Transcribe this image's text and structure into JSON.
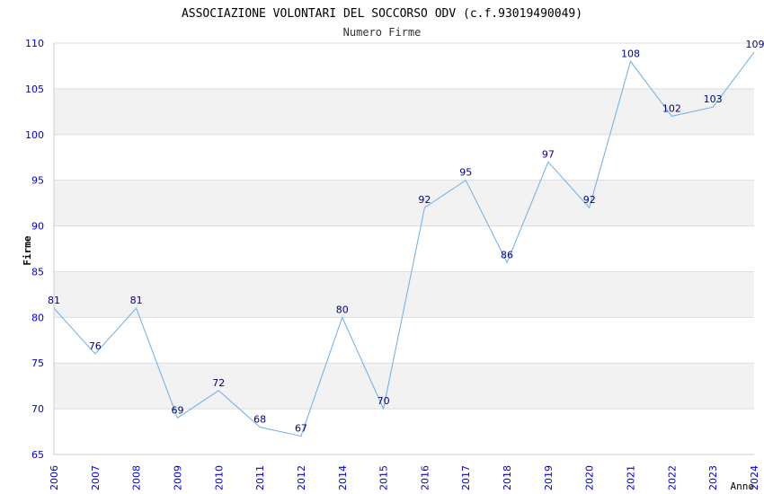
{
  "chart_data": {
    "type": "line",
    "title": "ASSOCIAZIONE VOLONTARI DEL SOCCORSO ODV (c.f.93019490049)",
    "subtitle": "Numero Firme",
    "xlabel": "Anno",
    "ylabel": "Firme",
    "ylim": [
      65,
      110
    ],
    "yticks": [
      65,
      70,
      75,
      80,
      85,
      90,
      95,
      100,
      105,
      110
    ],
    "grid": "horizontal bands",
    "x": [
      "2006",
      "2007",
      "2008",
      "2009",
      "2010",
      "2011",
      "2012",
      "2014",
      "2015",
      "2016",
      "2017",
      "2018",
      "2019",
      "2020",
      "2021",
      "2022",
      "2023",
      "2024"
    ],
    "series": [
      {
        "values": [
          81,
          76,
          81,
          69,
          72,
          68,
          67,
          80,
          70,
          92,
          95,
          86,
          97,
          92,
          108,
          102,
          103,
          109
        ]
      }
    ]
  },
  "colors": {
    "line": "#6aaee8",
    "axis_text": "#0000cc",
    "data_label": "#000080",
    "title": "#000000",
    "band": "#f2f2f2",
    "grid": "#dddddd"
  }
}
